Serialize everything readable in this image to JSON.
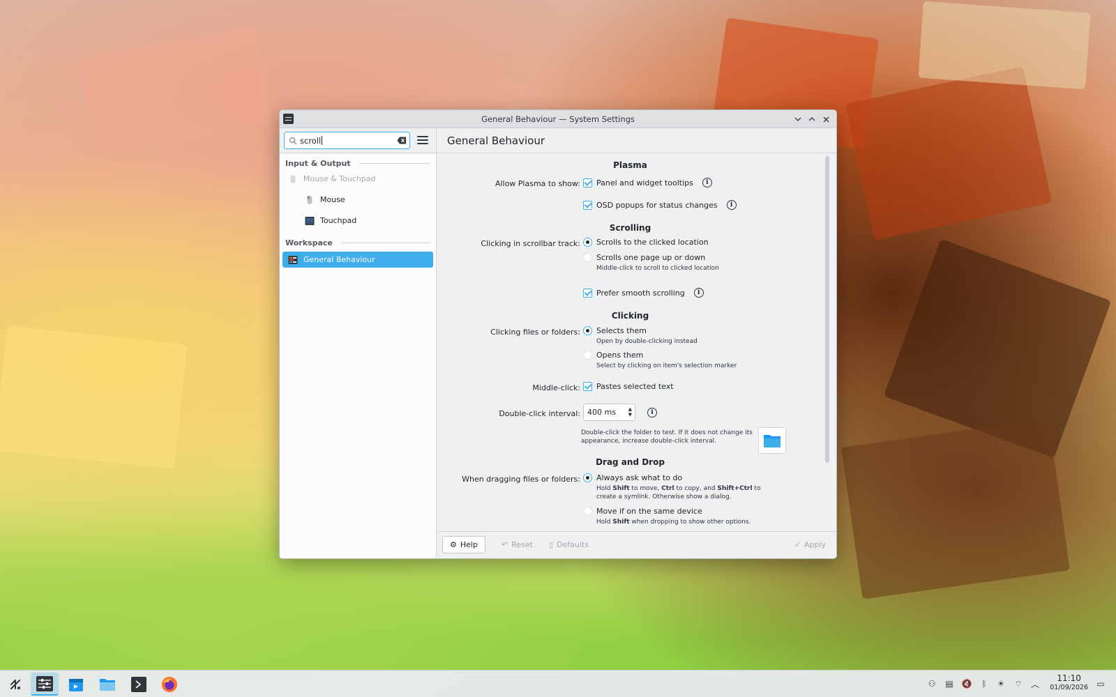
{
  "window": {
    "title": "General Behaviour — System Settings",
    "controls": [
      "chevron-down-icon",
      "chevron-up-icon",
      "close-icon"
    ]
  },
  "sidebar": {
    "search_value": "scroll",
    "sections": [
      {
        "title": "Input & Output"
      },
      {
        "title": "Workspace"
      }
    ],
    "items": [
      {
        "label": "Mouse & Touchpad",
        "icon": "mouse-icon",
        "state": "disabled"
      },
      {
        "label": "Mouse",
        "icon": "mouse-icon",
        "state": "normal"
      },
      {
        "label": "Touchpad",
        "icon": "touchpad-icon",
        "state": "normal"
      },
      {
        "label": "General Behaviour",
        "icon": "general-behaviour-icon",
        "state": "selected"
      }
    ]
  },
  "page": {
    "title": "General Behaviour",
    "plasma": {
      "title": "Plasma",
      "label": "Allow Plasma to show:",
      "opt1": "Panel and widget tooltips",
      "opt2": "OSD popups for status changes"
    },
    "scrolling": {
      "title": "Scrolling",
      "label": "Clicking in scrollbar track:",
      "opt1": "Scrolls to the clicked location",
      "opt2": "Scrolls one page up or down",
      "hint2": "Middle-click to scroll to clicked location",
      "smooth": "Prefer smooth scrolling"
    },
    "clicking": {
      "title": "Clicking",
      "label": "Clicking files or folders:",
      "opt1": "Selects them",
      "hint1": "Open by double-clicking instead",
      "opt2": "Opens them",
      "hint2": "Select by clicking on item's selection marker",
      "middle_label": "Middle-click:",
      "middle_opt": "Pastes selected text",
      "interval_label": "Double-click interval:",
      "interval_value": "400 ms",
      "test_hint": "Double-click the folder to test. If it does not change its appearance, increase double-click interval."
    },
    "dnd": {
      "title": "Drag and Drop",
      "label": "When dragging files or folders:",
      "opt1": "Always ask what to do",
      "hint1_a": "Hold ",
      "hint1_shift": "Shift",
      "hint1_b": " to move, ",
      "hint1_ctrl": "Ctrl",
      "hint1_c": " to copy, and ",
      "hint1_shiftctrl": "Shift+Ctrl",
      "hint1_d": " to create a symlink. Otherwise show a dialog.",
      "opt2": "Move if on the same device",
      "hint2_a": "Hold ",
      "hint2_shift": "Shift",
      "hint2_b": " when dropping to show other options."
    }
  },
  "footer": {
    "help": "Help",
    "reset": "Reset",
    "defaults": "Defaults",
    "apply": "Apply"
  },
  "taskbar": {
    "time": "11:10",
    "date": "01/09/2026",
    "apps": [
      "application-launcher-icon",
      "system-settings-icon",
      "discover-icon",
      "dolphin-icon",
      "konsole-icon",
      "firefox-icon"
    ]
  },
  "colors": {
    "accent": "#3daee9",
    "window_bg": "#eff0f1",
    "sidebar_bg": "#fcfcfc"
  }
}
